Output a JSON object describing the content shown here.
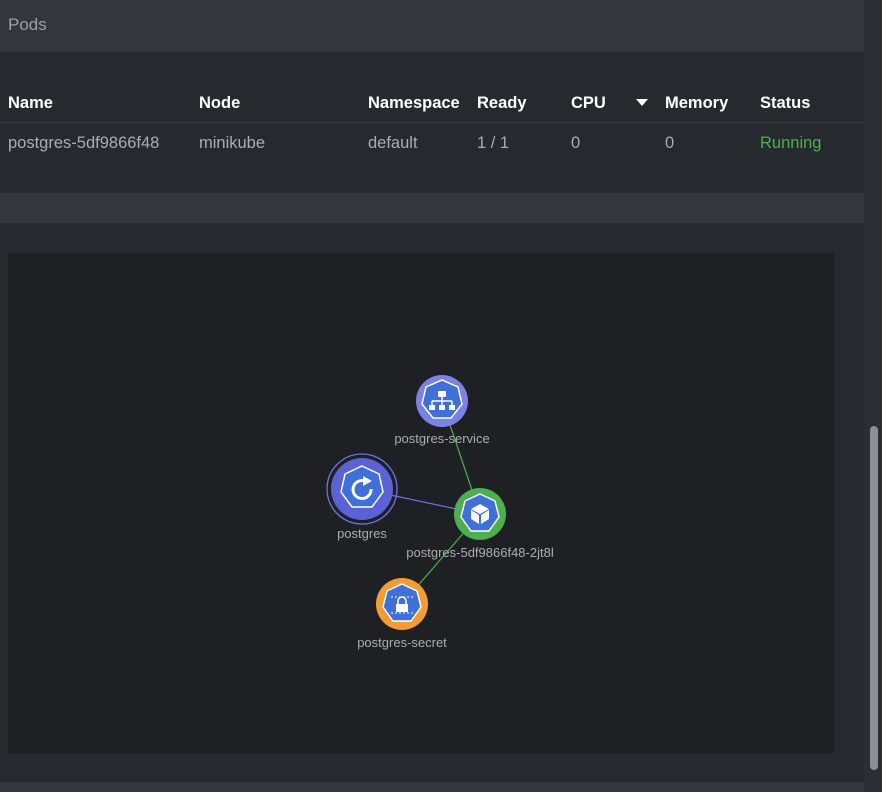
{
  "pods_panel": {
    "title": "Pods"
  },
  "table": {
    "columns": [
      "Name",
      "Node",
      "Namespace",
      "Ready",
      "CPU",
      "Memory",
      "Status"
    ],
    "sorted_column": "CPU",
    "rows": [
      {
        "name": "postgres-5df9866f48",
        "node": "minikube",
        "namespace": "default",
        "ready": "1 / 1",
        "cpu": "0",
        "memory": "0",
        "status": "Running"
      }
    ]
  },
  "graph": {
    "nodes": [
      {
        "id": "service",
        "label": "postgres-service",
        "kind": "service",
        "icon": "sitemap-icon",
        "color": "#6d74e0"
      },
      {
        "id": "deployment",
        "label": "postgres",
        "kind": "deployment",
        "icon": "refresh-icon",
        "color": "#5a62d6"
      },
      {
        "id": "pod",
        "label": "postgres-5df9866f48-2jt8l",
        "kind": "pod",
        "icon": "cube-icon",
        "color": "#4caf50"
      },
      {
        "id": "secret",
        "label": "postgres-secret",
        "kind": "secret",
        "icon": "lock-icon",
        "color": "#f39c32"
      }
    ],
    "edges": [
      {
        "from": "service",
        "to": "pod"
      },
      {
        "from": "deployment",
        "to": "pod"
      },
      {
        "from": "pod",
        "to": "secret"
      }
    ]
  },
  "colors": {
    "running": "#4caf50",
    "node_fill": "#3f6fd8"
  }
}
